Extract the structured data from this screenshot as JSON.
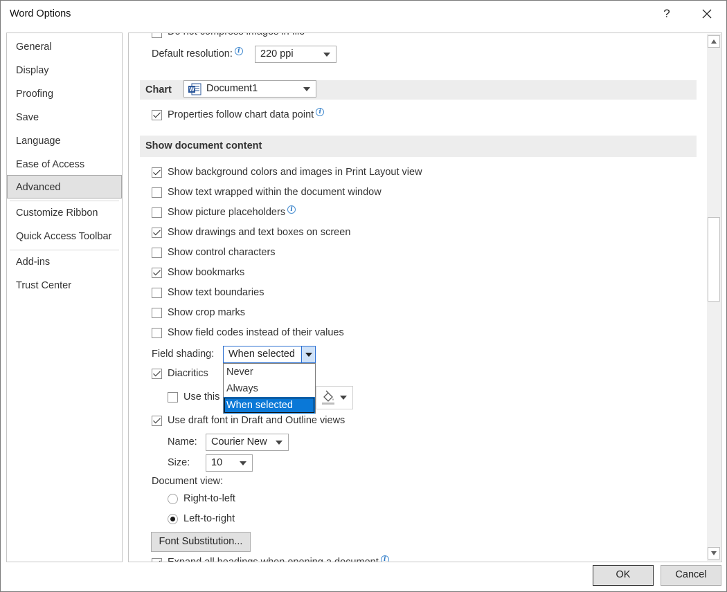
{
  "window": {
    "title": "Word Options",
    "help": "?"
  },
  "nav": {
    "items": [
      "General",
      "Display",
      "Proofing",
      "Save",
      "Language",
      "Ease of Access",
      "Advanced",
      "Customize Ribbon",
      "Quick Access Toolbar",
      "Add-ins",
      "Trust Center"
    ],
    "selected": "Advanced"
  },
  "image_section": {
    "compress_label_partial": "Do not compress images in file",
    "resolution_label": "Default resolution:",
    "resolution_value": "220 ppi"
  },
  "chart_section": {
    "header": "Chart",
    "document_value": "Document1",
    "properties_label": "Properties follow chart data point"
  },
  "show_content": {
    "header": "Show document content",
    "options": [
      {
        "label": "Show background colors and images in Print Layout view",
        "checked": true
      },
      {
        "label": "Show text wrapped within the document window",
        "checked": false
      },
      {
        "label": "Show picture placeholders",
        "checked": false
      },
      {
        "label": "Show drawings and text boxes on screen",
        "checked": true
      },
      {
        "label": "Show control characters",
        "checked": false
      },
      {
        "label": "Show bookmarks",
        "checked": true
      },
      {
        "label": "Show text boundaries",
        "checked": false
      },
      {
        "label": "Show crop marks",
        "checked": false
      },
      {
        "label": "Show field codes instead of their values",
        "checked": false
      }
    ],
    "field_shading_label": "Field shading:",
    "field_shading_value": "When selected",
    "field_shading_options": [
      "Never",
      "Always",
      "When selected"
    ],
    "diacritics_label": "Diacritics",
    "use_this_label": "Use this",
    "draft_font_label": "Use draft font in Draft and Outline views",
    "name_label": "Name:",
    "name_value": "Courier New",
    "size_label": "Size:",
    "size_value": "10",
    "document_view_label": "Document view:",
    "rtl_label": "Right-to-left",
    "ltr_label": "Left-to-right",
    "font_substitution_label": "Font Substitution...",
    "expand_headings_partial": "Expand all headings when opening a document"
  },
  "footer": {
    "ok": "OK",
    "cancel": "Cancel"
  }
}
